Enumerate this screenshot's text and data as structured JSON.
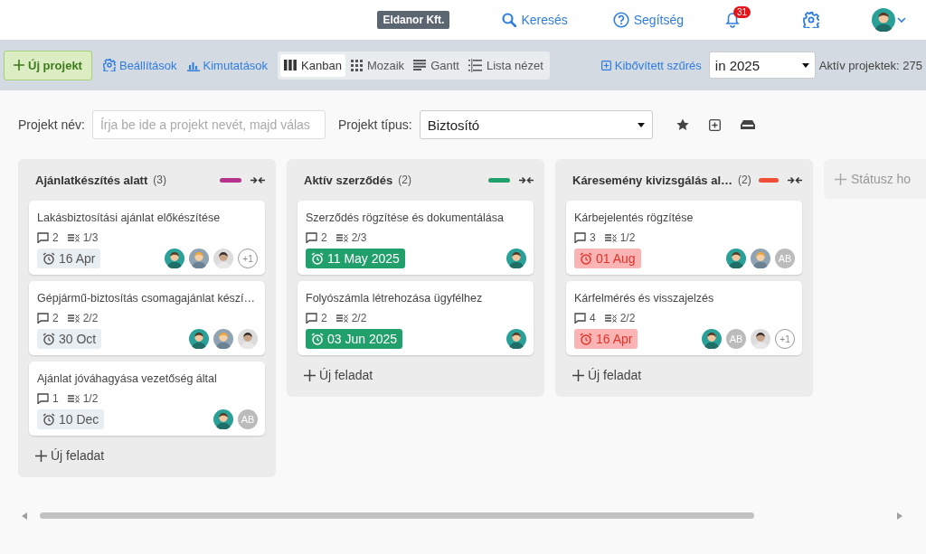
{
  "topbar": {
    "company": "Eldanor Kft.",
    "search": "Keresés",
    "help": "Segítség",
    "notification_count": "31"
  },
  "toolbar": {
    "new_project": "Új projekt",
    "settings": "Beállítások",
    "reports": "Kimutatások",
    "views": [
      {
        "label": "Kanban",
        "selected": true
      },
      {
        "label": "Mozaik",
        "selected": false
      },
      {
        "label": "Gantt",
        "selected": false
      },
      {
        "label": "Lista nézet",
        "selected": false
      }
    ],
    "advanced_filter": "Kibővített szűrés",
    "year_filter": "in 2025",
    "active_projects": "Aktív projektek: 275"
  },
  "filters": {
    "name_field": {
      "label": "Projekt név:",
      "placeholder": "Írja be ide a projekt nevét, majd válas"
    },
    "type_field": {
      "label": "Projekt típus:",
      "value": "Biztosító"
    }
  },
  "columns": [
    {
      "title": "Ajánlatkészítés alatt",
      "count": "(3)",
      "color": "#b5338a",
      "add_task": "Új feladat",
      "cards": [
        {
          "title": "Lakásbiztosítási ajánlat előkészítése",
          "comments": "2",
          "checklist": "1/3",
          "due": "16 Apr",
          "completed": false,
          "overdue": false,
          "assignees": [
            {
              "kind": "male"
            },
            {
              "kind": "female"
            },
            {
              "kind": "photo"
            },
            {
              "kind": "more",
              "text": "+1"
            }
          ]
        },
        {
          "title": "Gépjármű-biztosítás csomagajánlat készí…",
          "comments": "2",
          "checklist": "2/2",
          "due": "30 Oct",
          "completed": false,
          "overdue": false,
          "assignees": [
            {
              "kind": "male"
            },
            {
              "kind": "female"
            },
            {
              "kind": "photo"
            }
          ]
        },
        {
          "title": "Ajánlat jóváhagyása vezetőség által",
          "comments": "1",
          "checklist": "1/2",
          "due": "10 Dec",
          "completed": false,
          "overdue": false,
          "assignees": [
            {
              "kind": "male"
            },
            {
              "kind": "initials",
              "text": "AB"
            }
          ]
        }
      ]
    },
    {
      "title": "Aktív szerződés",
      "count": "(2)",
      "color": "#22a06b",
      "add_task": "Új feladat",
      "cards": [
        {
          "title": "Szerződés rögzítése és dokumentálása",
          "comments": "2",
          "checklist": "2/3",
          "due": "11 May 2025",
          "completed": true,
          "overdue": false,
          "assignees": [
            {
              "kind": "male"
            }
          ]
        },
        {
          "title": "Folyószámla létrehozása ügyfélhez",
          "comments": "2",
          "checklist": "2/2",
          "due": "03 Jun 2025",
          "completed": true,
          "overdue": false,
          "assignees": [
            {
              "kind": "male"
            }
          ]
        }
      ]
    },
    {
      "title": "Káresemény kivizsgálás al…",
      "count": "(2)",
      "color": "#f04e37",
      "add_task": "Új feladat",
      "cards": [
        {
          "title": "Kárbejelentés rögzítése",
          "comments": "3",
          "checklist": "1/2",
          "due": "01 Aug",
          "completed": false,
          "overdue": true,
          "assignees": [
            {
              "kind": "male"
            },
            {
              "kind": "female"
            },
            {
              "kind": "initials",
              "text": "AB"
            }
          ]
        },
        {
          "title": "Kárfelmérés és visszajelzés",
          "comments": "4",
          "checklist": "2/2",
          "due": "16 Apr",
          "completed": false,
          "overdue": true,
          "assignees": [
            {
              "kind": "male"
            },
            {
              "kind": "initials",
              "text": "AB"
            },
            {
              "kind": "photo"
            },
            {
              "kind": "more",
              "text": "+1"
            }
          ]
        }
      ]
    }
  ],
  "add_status": "Státusz ho"
}
